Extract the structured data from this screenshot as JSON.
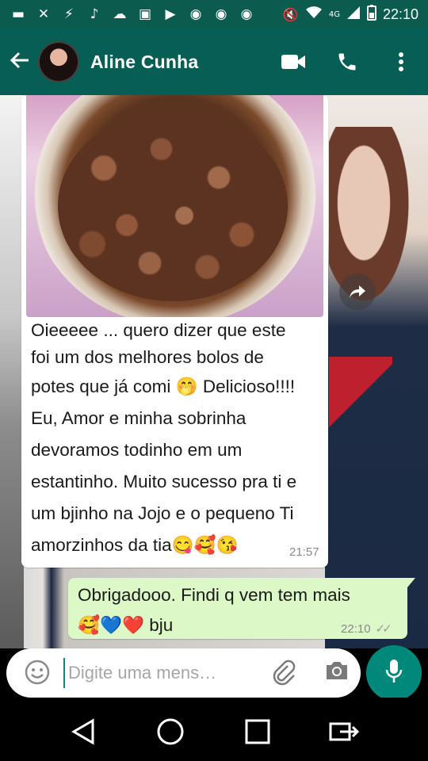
{
  "status_bar": {
    "time": "22:10",
    "network": "4G",
    "icons": [
      "message-icon",
      "missed-call-icon",
      "messenger-icon",
      "tiktok-icon",
      "cloud-icon",
      "gallery-icon",
      "youtube-icon",
      "chrome-icon",
      "chrome-icon",
      "chrome-icon",
      "mute-icon",
      "wifi-icon",
      "signal-icon",
      "battery-icon"
    ]
  },
  "header": {
    "contact_name": "Aline Cunha",
    "icons": [
      "back-arrow-icon",
      "video-call-icon",
      "phone-icon",
      "more-vert-icon"
    ]
  },
  "messages": [
    {
      "direction": "incoming",
      "has_image": true,
      "lines": [
        "Oieeeee ... quero dizer que este",
        "foi um dos melhores bolos de",
        "potes que já comi 🤭 Delicioso!!!!",
        "Eu, Amor e minha sobrinha",
        "devoramos todinho em um",
        "estantinho. Muito sucesso pra ti e",
        "um bjinho na Jojo e o pequeno Ti",
        "amorzinhos da tia😋🥰😘"
      ],
      "time": "21:57"
    },
    {
      "direction": "outgoing",
      "lines": [
        "Obrigadooo. Findi q vem tem mais",
        "🥰💙❤️ bju"
      ],
      "time": "22:10",
      "status": "read"
    }
  ],
  "input": {
    "placeholder": "Digite uma mens…"
  },
  "colors": {
    "header": "#075e54",
    "status_bar": "#0b5c4f",
    "outgoing_bubble": "#dcf8c6",
    "incoming_bubble": "#ffffff",
    "accent": "#00897b"
  }
}
